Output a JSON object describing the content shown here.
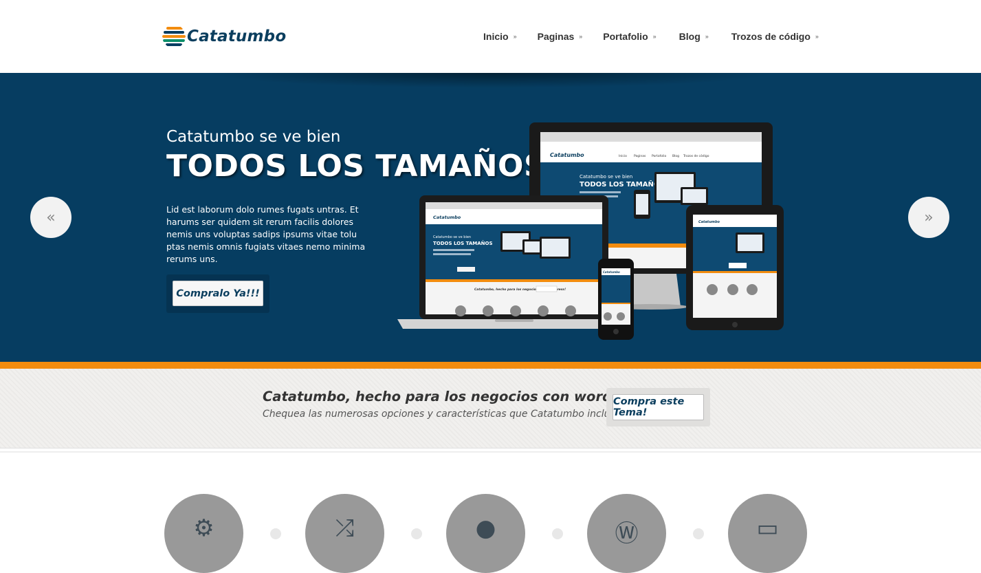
{
  "brand": {
    "name": "Catatumbo"
  },
  "nav": {
    "items": [
      {
        "label": "Inicio",
        "icon": "chevron-right-icon"
      },
      {
        "label": "Paginas",
        "icon": "chevron-right-icon"
      },
      {
        "label": "Portafolio",
        "icon": "chevron-right-icon"
      },
      {
        "label": "Blog",
        "icon": "chevron-right-icon"
      },
      {
        "label": "Trozos de código",
        "icon": "chevron-right-icon"
      }
    ]
  },
  "hero": {
    "subtitle": "Catatumbo se ve bien",
    "title": "TODOS LOS TAMAÑOS",
    "text": "Lid est laborum dolo rumes fugats untras. Et harums ser quidem sit rerum facilis dolores nemis uns voluptas sadips ipsums vitae tolu ptas nemis omnis fugiats vitaes nemo minima rerums uns.",
    "button_label": "Compralo Ya!!!",
    "prev_icon": "double-chevron-left-icon",
    "next_icon": "double-chevron-right-icon"
  },
  "screens": {
    "brand": "Catatumbo",
    "subtitle": "Catatumbo se ve bien",
    "title": "TODOS LOS TAMAÑOS",
    "cta": "Catatumbo, hecho para los negocios con wordpress!",
    "buy": "Compra este Tema!",
    "menu": [
      "Inicio",
      "Paginas",
      "Portafolio",
      "Blog",
      "Trozos de código"
    ]
  },
  "cta": {
    "title": "Catatumbo, hecho para los negocios con wordpress!",
    "subtitle": "Chequea las numerosas opciones y características que Catatumbo incluye.",
    "button_label": "Compra este Tema!"
  },
  "features": [
    {
      "icon": "gear-icon"
    },
    {
      "icon": "shuffle-icon"
    },
    {
      "icon": "users-icon"
    },
    {
      "icon": "wordpress-icon"
    },
    {
      "icon": "monitor-icon"
    }
  ],
  "colors": {
    "brand_blue": "#063d61",
    "accent_orange": "#f28c0f",
    "logo_text": "#0b3e5e"
  }
}
